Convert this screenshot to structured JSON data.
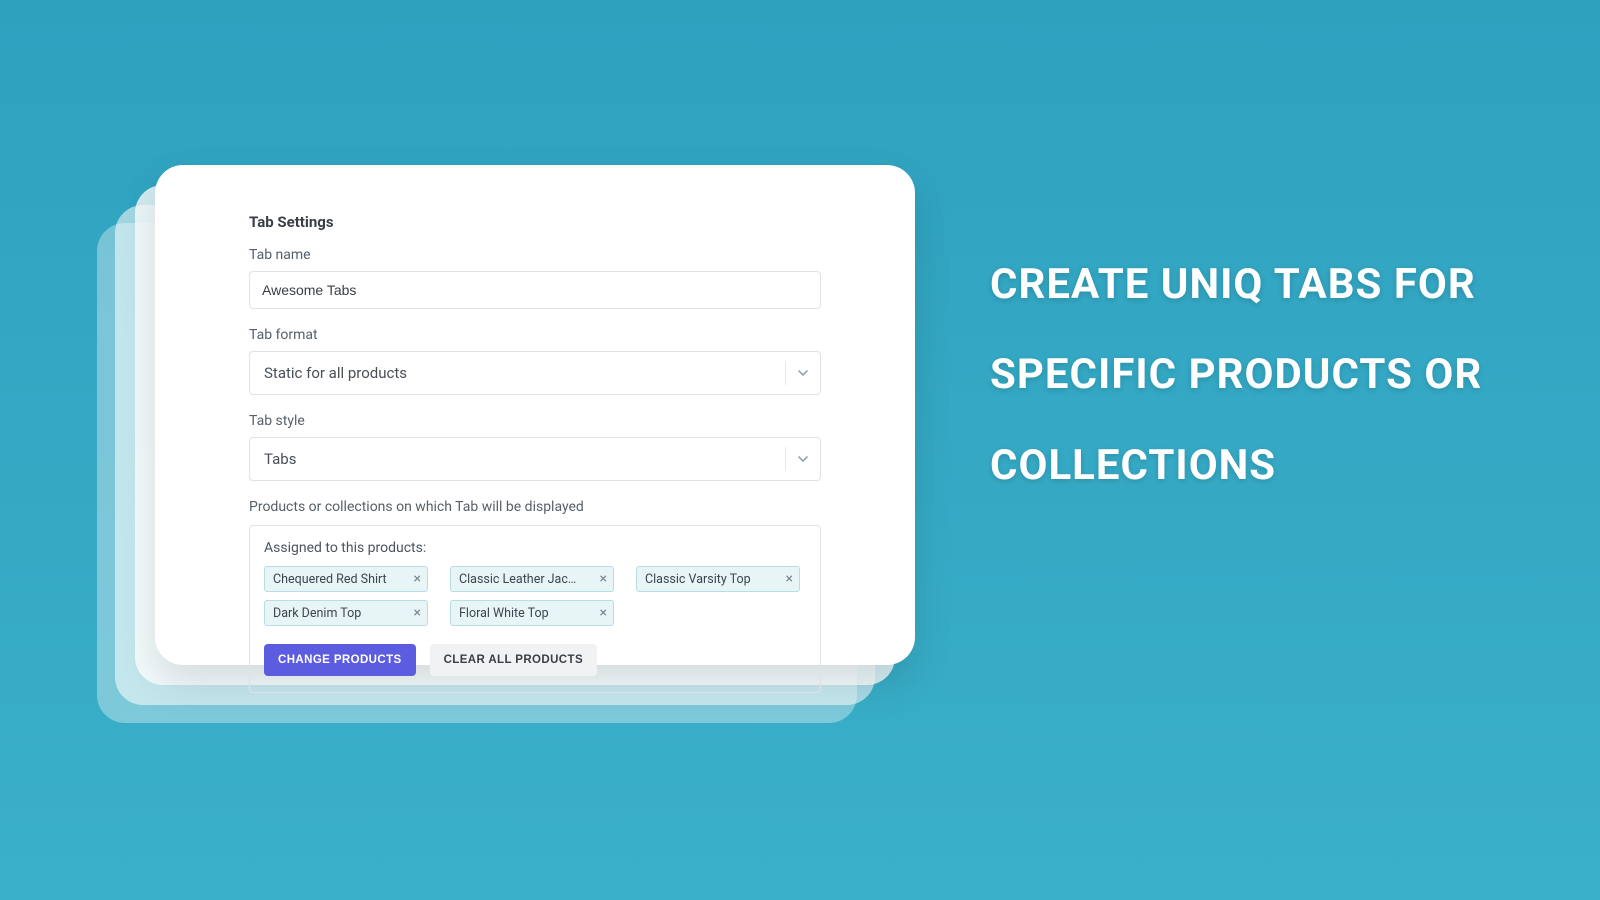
{
  "headline": "CREATE UNIQ TABS FOR SPECIFIC PRODUCTS OR COLLECTIONS",
  "card": {
    "title": "Tab Settings",
    "tab_name_label": "Tab name",
    "tab_name_value": "Awesome Tabs",
    "tab_format_label": "Tab format",
    "tab_format_value": "Static for all products",
    "tab_style_label": "Tab style",
    "tab_style_value": "Tabs",
    "assigned_section_label": "Products or collections on which Tab will be displayed",
    "assigned_to_label": "Assigned to this products:",
    "chips": [
      "Chequered Red Shirt",
      "Classic Leather Jac…",
      "Classic Varsity Top",
      "Dark Denim Top",
      "Floral White Top"
    ],
    "change_products_label": "CHANGE PRODUCTS",
    "clear_all_label": "CLEAR ALL PRODUCTS"
  }
}
